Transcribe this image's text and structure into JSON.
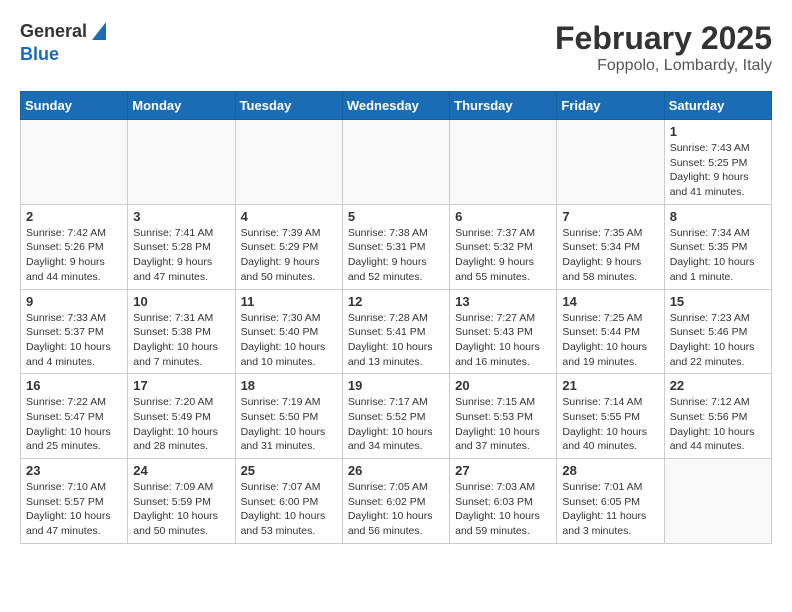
{
  "header": {
    "logo_general": "General",
    "logo_blue": "Blue",
    "month": "February 2025",
    "location": "Foppolo, Lombardy, Italy"
  },
  "weekdays": [
    "Sunday",
    "Monday",
    "Tuesday",
    "Wednesday",
    "Thursday",
    "Friday",
    "Saturday"
  ],
  "weeks": [
    [
      {
        "day": "",
        "info": ""
      },
      {
        "day": "",
        "info": ""
      },
      {
        "day": "",
        "info": ""
      },
      {
        "day": "",
        "info": ""
      },
      {
        "day": "",
        "info": ""
      },
      {
        "day": "",
        "info": ""
      },
      {
        "day": "1",
        "info": "Sunrise: 7:43 AM\nSunset: 5:25 PM\nDaylight: 9 hours and 41 minutes."
      }
    ],
    [
      {
        "day": "2",
        "info": "Sunrise: 7:42 AM\nSunset: 5:26 PM\nDaylight: 9 hours and 44 minutes."
      },
      {
        "day": "3",
        "info": "Sunrise: 7:41 AM\nSunset: 5:28 PM\nDaylight: 9 hours and 47 minutes."
      },
      {
        "day": "4",
        "info": "Sunrise: 7:39 AM\nSunset: 5:29 PM\nDaylight: 9 hours and 50 minutes."
      },
      {
        "day": "5",
        "info": "Sunrise: 7:38 AM\nSunset: 5:31 PM\nDaylight: 9 hours and 52 minutes."
      },
      {
        "day": "6",
        "info": "Sunrise: 7:37 AM\nSunset: 5:32 PM\nDaylight: 9 hours and 55 minutes."
      },
      {
        "day": "7",
        "info": "Sunrise: 7:35 AM\nSunset: 5:34 PM\nDaylight: 9 hours and 58 minutes."
      },
      {
        "day": "8",
        "info": "Sunrise: 7:34 AM\nSunset: 5:35 PM\nDaylight: 10 hours and 1 minute."
      }
    ],
    [
      {
        "day": "9",
        "info": "Sunrise: 7:33 AM\nSunset: 5:37 PM\nDaylight: 10 hours and 4 minutes."
      },
      {
        "day": "10",
        "info": "Sunrise: 7:31 AM\nSunset: 5:38 PM\nDaylight: 10 hours and 7 minutes."
      },
      {
        "day": "11",
        "info": "Sunrise: 7:30 AM\nSunset: 5:40 PM\nDaylight: 10 hours and 10 minutes."
      },
      {
        "day": "12",
        "info": "Sunrise: 7:28 AM\nSunset: 5:41 PM\nDaylight: 10 hours and 13 minutes."
      },
      {
        "day": "13",
        "info": "Sunrise: 7:27 AM\nSunset: 5:43 PM\nDaylight: 10 hours and 16 minutes."
      },
      {
        "day": "14",
        "info": "Sunrise: 7:25 AM\nSunset: 5:44 PM\nDaylight: 10 hours and 19 minutes."
      },
      {
        "day": "15",
        "info": "Sunrise: 7:23 AM\nSunset: 5:46 PM\nDaylight: 10 hours and 22 minutes."
      }
    ],
    [
      {
        "day": "16",
        "info": "Sunrise: 7:22 AM\nSunset: 5:47 PM\nDaylight: 10 hours and 25 minutes."
      },
      {
        "day": "17",
        "info": "Sunrise: 7:20 AM\nSunset: 5:49 PM\nDaylight: 10 hours and 28 minutes."
      },
      {
        "day": "18",
        "info": "Sunrise: 7:19 AM\nSunset: 5:50 PM\nDaylight: 10 hours and 31 minutes."
      },
      {
        "day": "19",
        "info": "Sunrise: 7:17 AM\nSunset: 5:52 PM\nDaylight: 10 hours and 34 minutes."
      },
      {
        "day": "20",
        "info": "Sunrise: 7:15 AM\nSunset: 5:53 PM\nDaylight: 10 hours and 37 minutes."
      },
      {
        "day": "21",
        "info": "Sunrise: 7:14 AM\nSunset: 5:55 PM\nDaylight: 10 hours and 40 minutes."
      },
      {
        "day": "22",
        "info": "Sunrise: 7:12 AM\nSunset: 5:56 PM\nDaylight: 10 hours and 44 minutes."
      }
    ],
    [
      {
        "day": "23",
        "info": "Sunrise: 7:10 AM\nSunset: 5:57 PM\nDaylight: 10 hours and 47 minutes."
      },
      {
        "day": "24",
        "info": "Sunrise: 7:09 AM\nSunset: 5:59 PM\nDaylight: 10 hours and 50 minutes."
      },
      {
        "day": "25",
        "info": "Sunrise: 7:07 AM\nSunset: 6:00 PM\nDaylight: 10 hours and 53 minutes."
      },
      {
        "day": "26",
        "info": "Sunrise: 7:05 AM\nSunset: 6:02 PM\nDaylight: 10 hours and 56 minutes."
      },
      {
        "day": "27",
        "info": "Sunrise: 7:03 AM\nSunset: 6:03 PM\nDaylight: 10 hours and 59 minutes."
      },
      {
        "day": "28",
        "info": "Sunrise: 7:01 AM\nSunset: 6:05 PM\nDaylight: 11 hours and 3 minutes."
      },
      {
        "day": "",
        "info": ""
      }
    ]
  ]
}
